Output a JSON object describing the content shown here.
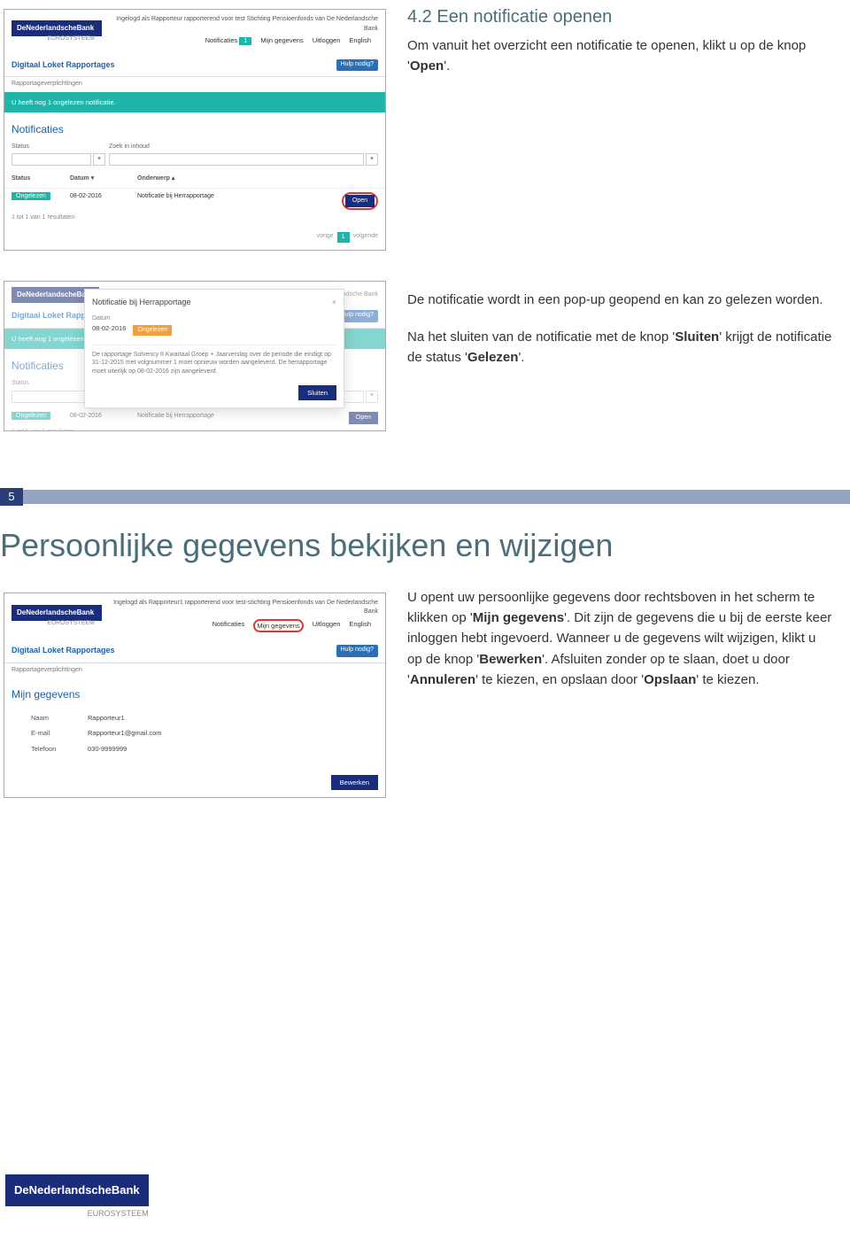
{
  "brand": {
    "name": "DeNederlandscheBank",
    "sub": "EUROSYSTEEM"
  },
  "sec42": {
    "heading": "4.2  Een notificatie openen",
    "p1_a": "Om vanuit het overzicht een notificatie te openen, klikt u op de knop '",
    "p1_kw": "Open",
    "p1_b": "'.",
    "p2": "De notificatie wordt in een pop-up geopend en kan zo gelezen worden.",
    "p3_a": "Na het sluiten van de notificatie met de knop '",
    "p3_kw": "Sluiten",
    "p3_b": "' krijgt de notificatie de status '",
    "p3_kw2": "Gelezen",
    "p3_c": "'."
  },
  "shot1": {
    "login_line": "Ingelogd als Rapporteur rapporterend voor test Stichting Pensioenfonds van De Nederlandsche Bank",
    "nav": {
      "notif": "Notificaties",
      "notif_badge": "1",
      "mijn": "Mijn gegevens",
      "uitloggen": "Uitloggen",
      "english": "English"
    },
    "app_title": "Digitaal Loket Rapportages",
    "hulp": "Hulp nodig?",
    "breadcrumb": "Rapportageverplichtingen",
    "banner": "U heeft nog 1 ongelezen notificatie.",
    "section": "Notificaties",
    "filters": {
      "status": "Status",
      "zoek": "Zoek in inhoud"
    },
    "table": {
      "head": {
        "status": "Status",
        "datum": "Datum ▾",
        "onderwerp": "Onderwerp ▴"
      },
      "row": {
        "status": "Ongelezen",
        "datum": "08-02-2016",
        "onderwerp": "Notificatie bij Herrapportage",
        "open": "Open"
      }
    },
    "results": "1 tot 1 van 1 resultaten",
    "pager": {
      "prev": "vorige",
      "page": "1",
      "next": "volgende"
    }
  },
  "shot2": {
    "popup": {
      "title": "Notificatie bij Herrapportage",
      "date_label": "Datum",
      "date": "08-02-2016",
      "badge": "Ongelezen",
      "body": "De rapportage Solvency II Kwartaal Groep + Jaarverslag over de periode die eindigt op 31-12-2015 met volgnummer 1 moet opnieuw worden aangeleverd. De herrapportage moet uiterlijk op 08-02-2016 zijn aangeleverd.",
      "close_btn": "Sluiten"
    }
  },
  "sec5": {
    "num": "5",
    "title": "Persoonlijke gegevens bekijken en wijzigen",
    "p_a": "U opent uw persoonlijke gegevens door rechtsboven in het scherm te klikken op '",
    "kw1": "Mijn gegevens",
    "p_b": "'. Dit zijn de gegevens die u bij de eerste keer inloggen hebt ingevoerd. Wanneer u de gegevens wilt wijzigen, klikt u op de knop '",
    "kw2": "Bewerken",
    "p_c": "'. Afsluiten zonder op te slaan, doet u door '",
    "kw3": "Annuleren",
    "p_d": "' te kiezen, en opslaan door '",
    "kw4": "Opslaan",
    "p_e": "' te kiezen."
  },
  "shot3": {
    "login_line": "Ingelogd als Rapporteur1 rapporterend voor test-stichting Pensioenfonds van De Nederlandsche Bank",
    "nav": {
      "notif": "Notificaties",
      "mijn": "Mijn gegevens",
      "uitloggen": "Uitloggen",
      "english": "English"
    },
    "app_title": "Digitaal Loket Rapportages",
    "hulp": "Hulp nodig?",
    "breadcrumb": "Rapportageverplichtingen",
    "section": "Mijn gegevens",
    "fields": {
      "naam_l": "Naam",
      "naam_v": "Rapporteur1",
      "email_l": "E-mail",
      "email_v": "Rapporteur1@gmail.com",
      "tel_l": "Telefoon",
      "tel_v": "030-9999999"
    },
    "edit": "Bewerken"
  }
}
